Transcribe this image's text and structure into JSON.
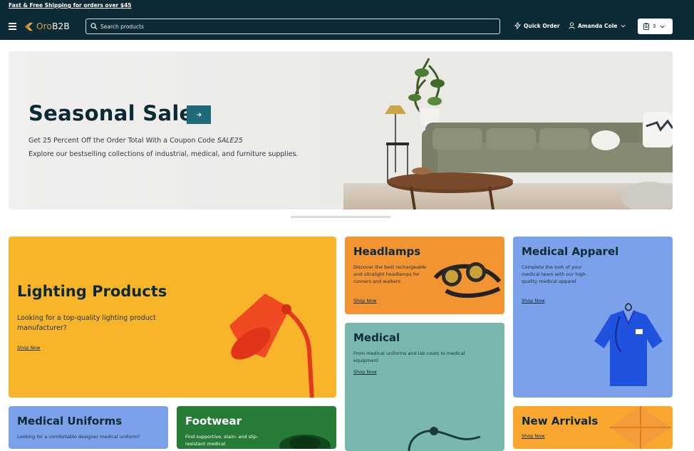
{
  "promo_bar": {
    "text": "Fast & Free Shipping for orders over $45"
  },
  "header": {
    "logo_prefix": "Oro",
    "logo_suffix": "B2B",
    "search_placeholder": "Search products",
    "quick_order_label": "Quick Order",
    "user_name": "Amanda Cole",
    "cart_count": "3"
  },
  "hero": {
    "title": "Seasonal Sale",
    "line1_prefix": "Get 25 Percent Off the Order Total With a Coupon Code ",
    "line1_code": "SALE25",
    "line2": "Explore our bestselling collections of industrial, medical, and furniture supplies."
  },
  "tiles": {
    "lighting": {
      "title": "Lighting Products",
      "desc": "Looking for a top-quality lighting product manufacturer?",
      "link": "Shop Now"
    },
    "headlamps": {
      "title": "Headlamps",
      "desc": "Discover the best rechargeable and ultralight headlamps for runners and walkers",
      "link": "Shop Now"
    },
    "medical": {
      "title": "Medical",
      "desc": "From medical uniforms and lab coats to medical equipment",
      "link": "Shop Now"
    },
    "apparel": {
      "title": "Medical Apparel",
      "desc": "Complete the look of your medical team with our high-quality medical apparel",
      "link": "Shop Now"
    },
    "uniforms": {
      "title": "Medical Uniforms",
      "desc": "Looking for a comfortable designer medical uniform?"
    },
    "footwear": {
      "title": "Footwear",
      "desc": "Find supportive, stain- and slip-resistant medical"
    },
    "arrivals": {
      "title": "New Arrivals",
      "link": "Shop Now"
    }
  },
  "colors": {
    "header_bg": "#0c2a36",
    "accent": "#1e6a78",
    "lighting_bg": "#f9b52a",
    "headlamps_bg": "#f39433",
    "medical_bg": "#7ab7ae",
    "apparel_bg": "#7aa1ea",
    "footwear_bg": "#267b37",
    "arrivals_bg": "#f9a72e"
  }
}
